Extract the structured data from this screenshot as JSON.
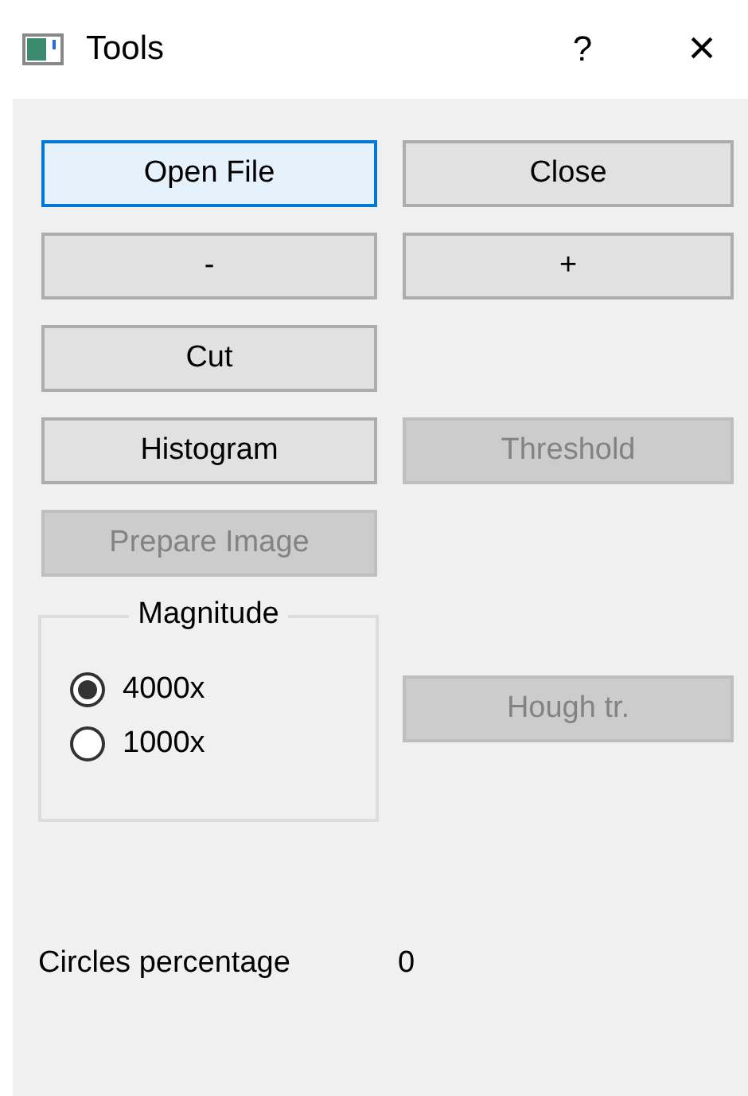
{
  "window": {
    "title": "Tools",
    "help": "?",
    "close": "×"
  },
  "button_rows": [
    [
      {
        "label": "Open File",
        "focused": true,
        "disabled": false
      },
      {
        "label": "Close",
        "focused": false,
        "disabled": false
      }
    ],
    [
      {
        "label": "-",
        "focused": false,
        "disabled": false
      },
      {
        "label": "+",
        "focused": false,
        "disabled": false
      }
    ],
    [
      {
        "label": "Cut",
        "focused": false,
        "disabled": false
      }
    ],
    [
      {
        "label": "Histogram",
        "focused": false,
        "disabled": false
      },
      {
        "label": "Threshold",
        "focused": false,
        "disabled": true
      }
    ],
    [
      {
        "label": "Prepare Image",
        "focused": false,
        "disabled": true
      }
    ]
  ],
  "magnitude": {
    "title": "Magnitude",
    "options": [
      {
        "label": "4000x",
        "selected": true
      },
      {
        "label": "1000x",
        "selected": false
      }
    ]
  },
  "hough_button": {
    "label": "Hough tr.",
    "focused": false,
    "disabled": true
  },
  "circles": {
    "label": "Circles percentage",
    "value": "0"
  }
}
